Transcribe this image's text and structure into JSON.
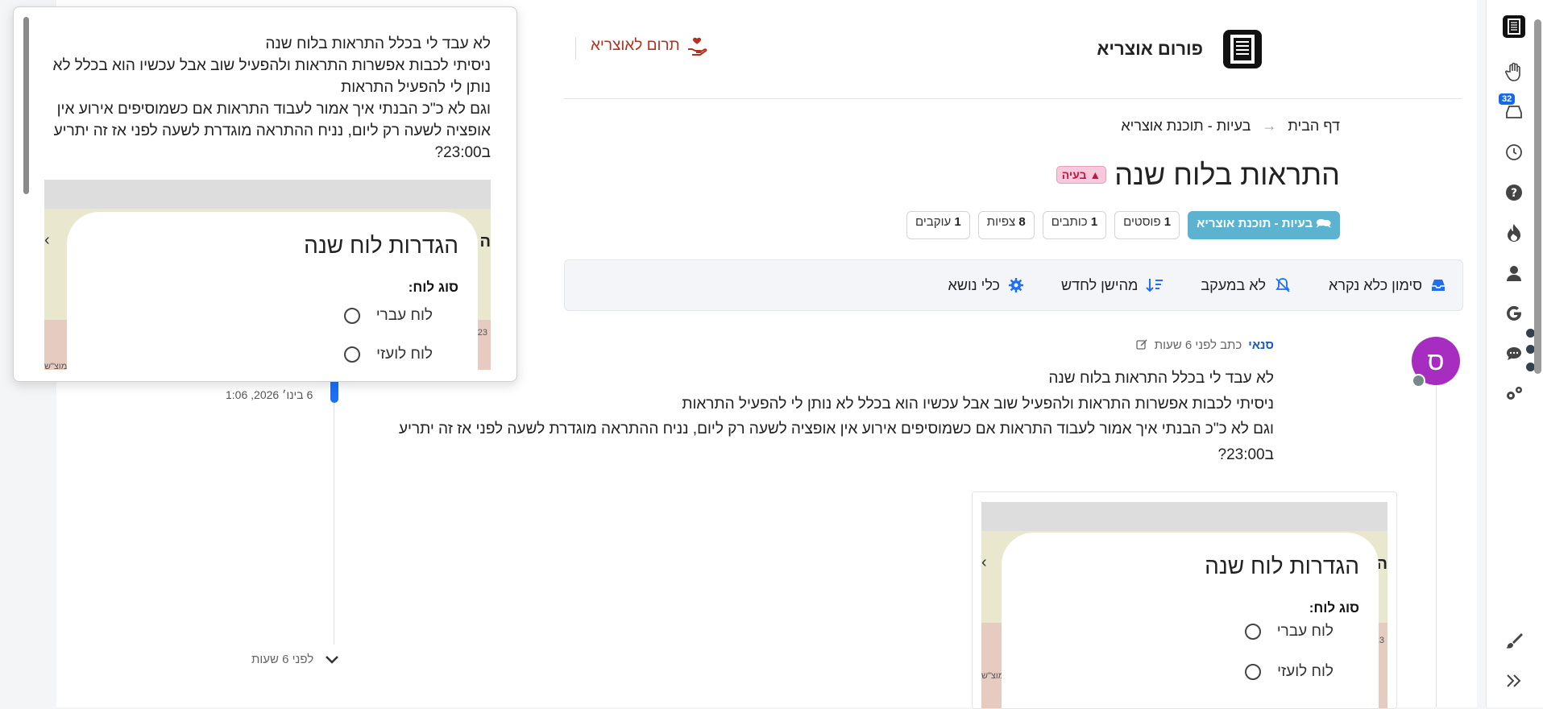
{
  "header": {
    "site_title": "פורום אוצריא",
    "donate_label": "תרום לאוצריא"
  },
  "breadcrumb": {
    "home": "דף הבית",
    "arrow": "→",
    "category": "בעיות - תוכנת אוצריא"
  },
  "topic": {
    "badge": "בעיה",
    "title": "התראות בלוח שנה",
    "category_chip": "בעיות - תוכנת אוצריא",
    "stats": [
      {
        "num": "1",
        "label": "פוסטים"
      },
      {
        "num": "1",
        "label": "כותבים"
      },
      {
        "num": "8",
        "label": "צפיות"
      },
      {
        "num": "1",
        "label": "עוקבים"
      }
    ]
  },
  "toolbar": {
    "mark_read": "סימון כלא נקרא",
    "not_watching": "לא במעקב",
    "sort": "מהישן לחדש",
    "topic_tools": "כלי נושא"
  },
  "post": {
    "avatar_letter": "ס",
    "author": "סנאי",
    "meta": "כתב לפני 6 שעות",
    "lines": [
      "לא עבד לי בכלל התראות בלוח שנה",
      "ניסיתי לכבות אפשרות התראות ולהפעיל שוב אבל עכשיו הוא בכלל לא נותן לי להפעיל התראות",
      "וגם לא כ\"כ הבנתי איך אמור לעבוד התראות אם כשמוסיפים אירוע אין אופציה לשעה רק ליום, נניח ההתראה מוגדרת לשעה לפני אז זה יתריע",
      "ב23:00?"
    ],
    "image": {
      "dialog_title": "הגדרות לוח שנה",
      "calendar_type_label": "סוג לוח:",
      "option_hebrew": "לוח עברי",
      "option_gregorian": "לוח לועזי",
      "bg_fragment": "מוצ\"ש",
      "bg_fragment2": "23",
      "bg_letter": "ה"
    }
  },
  "timeline": {
    "date": "6 בינו׳ 2026, 1:06",
    "ago": "לפני 6 שעות"
  },
  "popup": {
    "lines": [
      "לא עבד לי בכלל התראות בלוח שנה",
      "ניסיתי לכבות אפשרות התראות ולהפעיל שוב אבל עכשיו הוא בכלל לא נותן לי להפעיל התראות",
      "וגם לא כ\"כ הבנתי איך אמור לעבוד התראות אם כשמוסיפים אירוע אין אופציה לשעה רק ליום, נניח ההתראה מוגדרת לשעה לפני אז זה יתריע ב23:00?"
    ],
    "image": {
      "dialog_title": "הגדרות לוח שנה",
      "calendar_type_label": "סוג לוח:",
      "option_hebrew": "לוח עברי",
      "option_gregorian": "לוח לועזי",
      "bg_fragment": "מוצ\"ש",
      "bg_fragment2": "23",
      "bg_letter": "ה"
    }
  },
  "sidebar": {
    "notifications_count": "32",
    "icons": [
      "forum-logo-icon",
      "hand-icon",
      "inbox-icon",
      "clock-icon",
      "help-icon",
      "fire-icon",
      "user-icon",
      "google-icon",
      "chat-icon",
      "settings-icon",
      "brush-icon",
      "collapse-icon"
    ]
  },
  "colors": {
    "accent": "#1e6ff2",
    "avatar": "#a72cc0",
    "donate": "#b3311f",
    "category": "#5bb3d0",
    "issue_badge": "#f8c8dc"
  }
}
